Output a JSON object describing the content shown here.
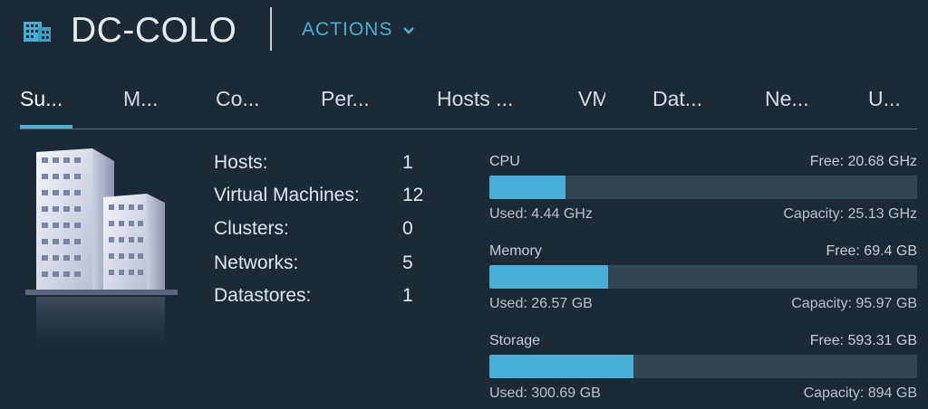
{
  "header": {
    "title": "DC-COLO",
    "actions_label": "ACTIONS",
    "icon": "datacenter-icon",
    "accent_color": "#49afd9"
  },
  "tabs": [
    {
      "label": "Su...",
      "active": true
    },
    {
      "label": "M..."
    },
    {
      "label": "Co..."
    },
    {
      "label": "Per..."
    },
    {
      "label": "Hosts ..."
    },
    {
      "label": "VM"
    },
    {
      "label": "Dat..."
    },
    {
      "label": "Ne..."
    },
    {
      "label": "U..."
    }
  ],
  "summary": {
    "image": "datacenter-building-icon",
    "stats": [
      {
        "label": "Hosts:",
        "value": "1"
      },
      {
        "label": "Virtual Machines:",
        "value": "12"
      },
      {
        "label": "Clusters:",
        "value": "0"
      },
      {
        "label": "Networks:",
        "value": "5"
      },
      {
        "label": "Datastores:",
        "value": "1"
      }
    ]
  },
  "resources": [
    {
      "name": "CPU",
      "free": "Free: 20.68 GHz",
      "used": "Used: 4.44 GHz",
      "capacity": "Capacity: 25.13 GHz",
      "used_fraction": 0.177
    },
    {
      "name": "Memory",
      "free": "Free: 69.4 GB",
      "used": "Used: 26.57 GB",
      "capacity": "Capacity: 95.97 GB",
      "used_fraction": 0.277
    },
    {
      "name": "Storage",
      "free": "Free: 593.31 GB",
      "used": "Used: 300.69 GB",
      "capacity": "Capacity: 894 GB",
      "used_fraction": 0.336
    }
  ]
}
